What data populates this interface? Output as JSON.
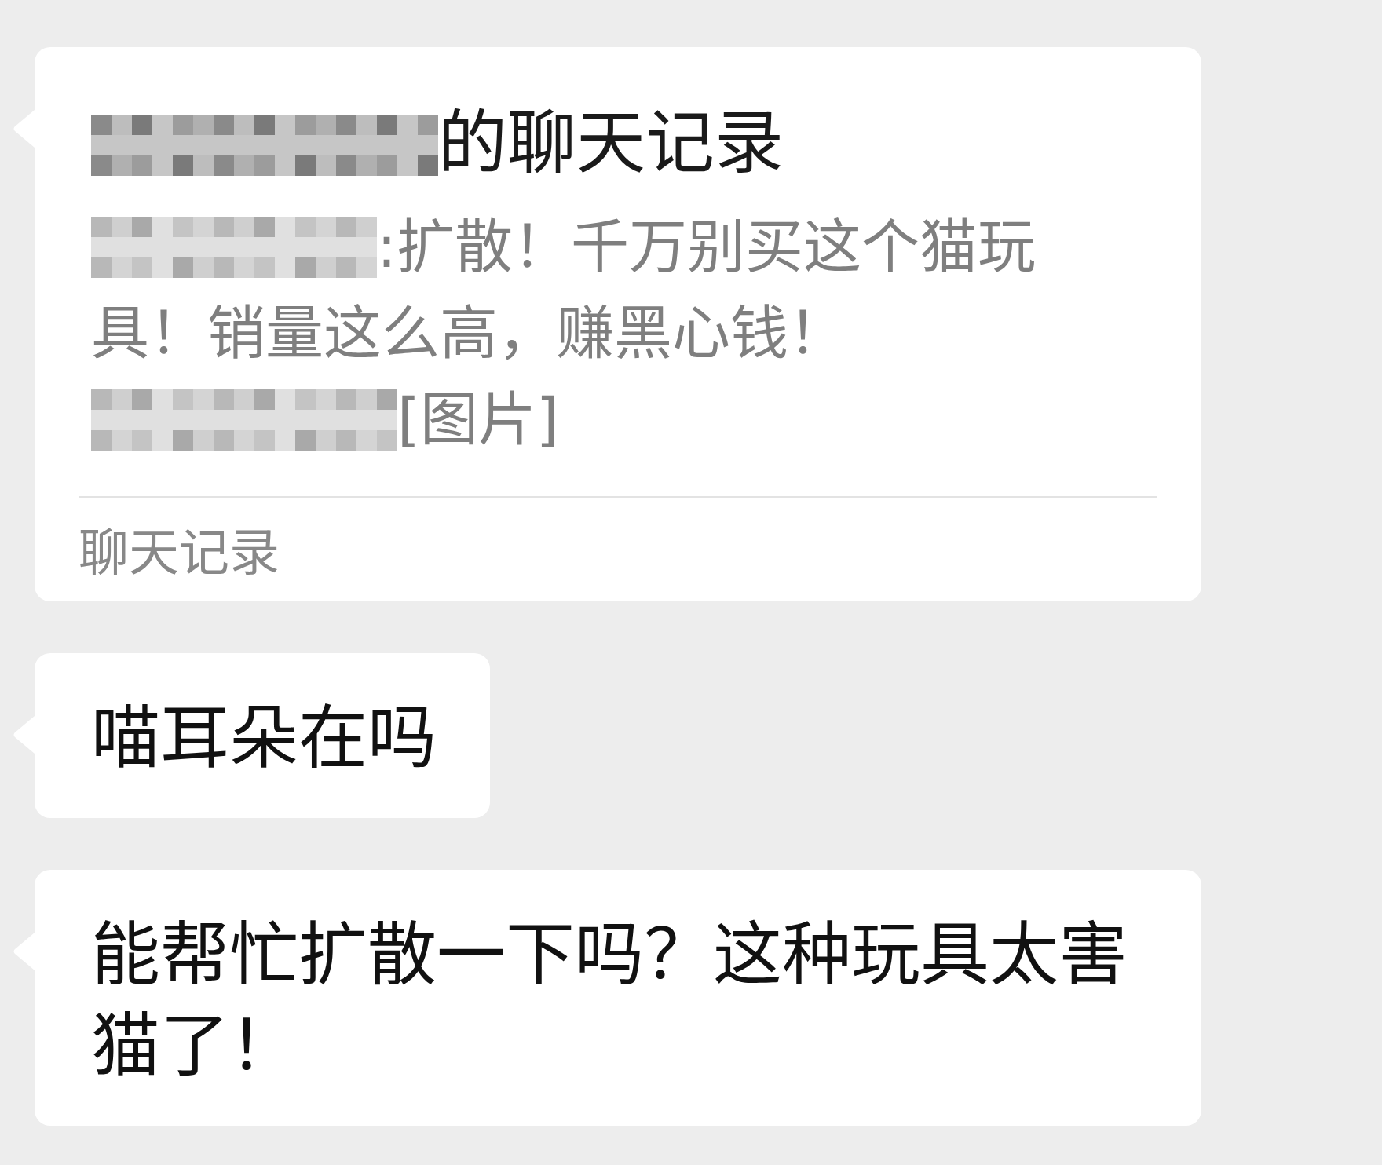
{
  "messages": [
    {
      "kind": "chat_record",
      "title": {
        "name_hidden": true,
        "text": "的聊天记录"
      },
      "lines": [
        {
          "name_hidden": true,
          "text": ":扩散！千万别买这个猫玩"
        },
        {
          "name_hidden": false,
          "text": "具！销量这么高，赚黑心钱！"
        },
        {
          "name_hidden": true,
          "text": "[图片]"
        }
      ],
      "footer": "聊天记录"
    },
    {
      "kind": "text",
      "text": "喵耳朵在吗"
    },
    {
      "kind": "text",
      "text": "能帮忙扩散一下吗？这种玩具太害猫了！"
    }
  ]
}
